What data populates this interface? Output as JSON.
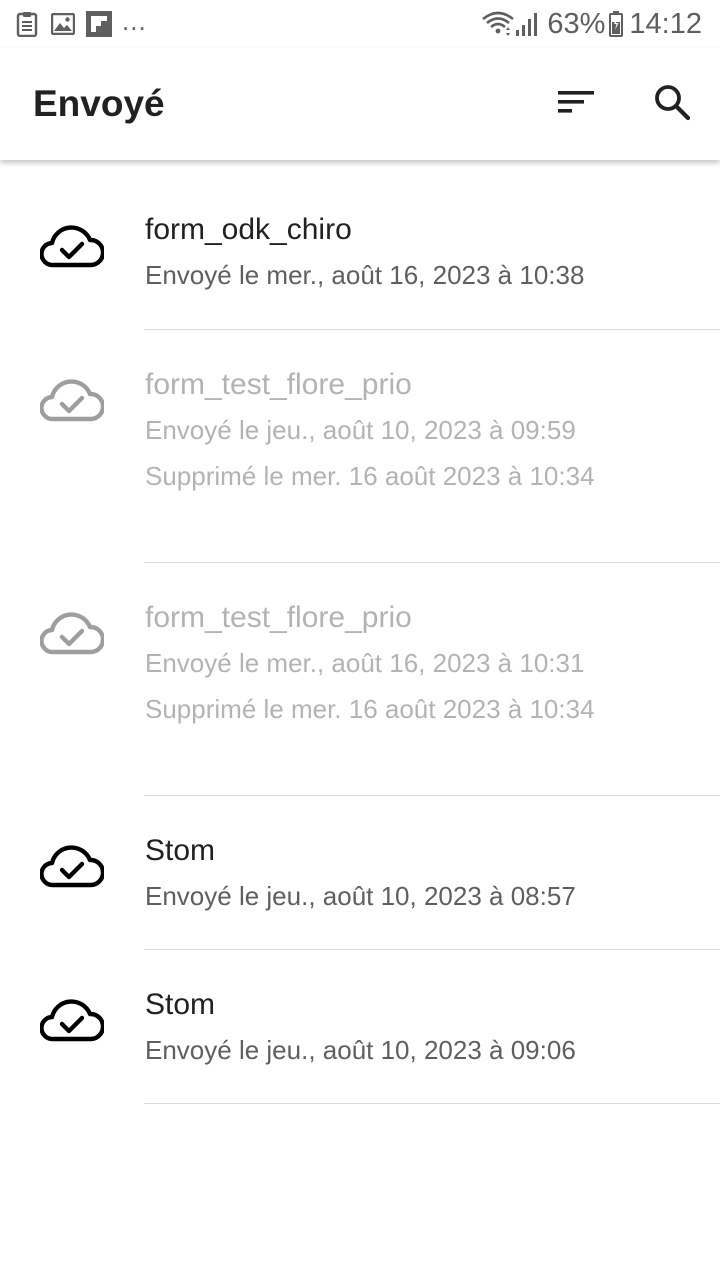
{
  "status_bar": {
    "notification_icons": [
      "clipboard-icon",
      "image-icon",
      "flipboard-icon"
    ],
    "more": "...",
    "battery": "63%",
    "time": "14:12"
  },
  "app_bar": {
    "title": "Envoyé",
    "actions": [
      "sort-icon",
      "search-icon"
    ]
  },
  "colors": {
    "primary_text": "#212121",
    "secondary_text": "#5f5f5f",
    "disabled_text": "#b3b3b3",
    "divider": "#dcdcdc"
  },
  "forms": [
    {
      "name": "form_odk_chiro",
      "sent": "Envoyé le mer., août 16, 2023 à 10:38",
      "deleted": "",
      "is_deleted": false
    },
    {
      "name": "form_test_flore_prio",
      "sent": "Envoyé le jeu., août 10, 2023 à 09:59",
      "deleted": "Supprimé le mer. 16 août 2023 à 10:34",
      "is_deleted": true
    },
    {
      "name": "form_test_flore_prio",
      "sent": "Envoyé le mer., août 16, 2023 à 10:31",
      "deleted": "Supprimé le mer. 16 août 2023 à 10:34",
      "is_deleted": true
    },
    {
      "name": "Stom",
      "sent": "Envoyé le jeu., août 10, 2023 à 08:57",
      "deleted": "",
      "is_deleted": false
    },
    {
      "name": "Stom",
      "sent": "Envoyé le jeu., août 10, 2023 à 09:06",
      "deleted": "",
      "is_deleted": false
    }
  ]
}
